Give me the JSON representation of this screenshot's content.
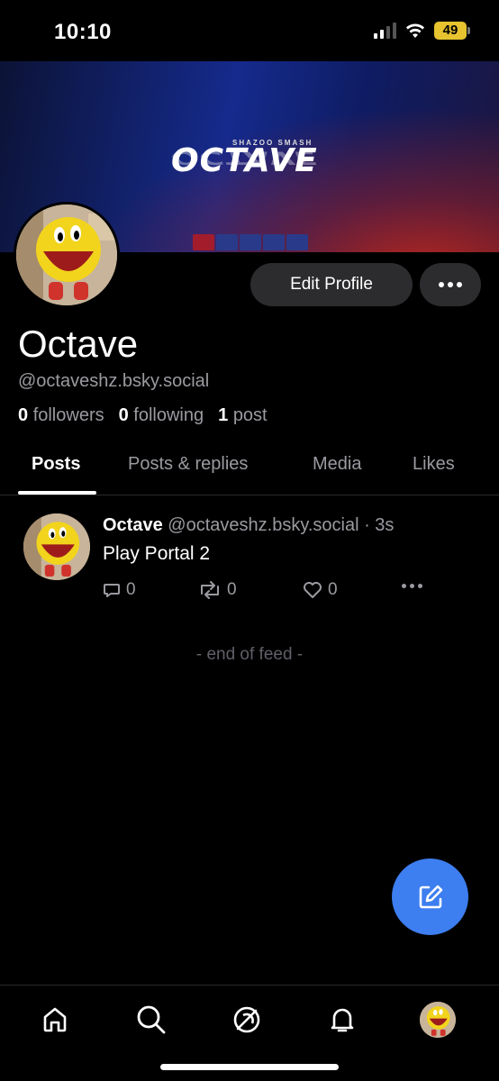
{
  "status_bar": {
    "time": "10:10",
    "battery": "49"
  },
  "banner": {
    "subtitle": "SHAZOO SMASH",
    "title": "OCTAVE"
  },
  "profile": {
    "display_name": "Octave",
    "handle": "@octaveshz.bsky.social",
    "edit_label": "Edit Profile",
    "followers_count": "0",
    "followers_label": "followers",
    "following_count": "0",
    "following_label": "following",
    "posts_count": "1",
    "posts_label": "post"
  },
  "tabs": [
    {
      "label": "Posts",
      "active": true
    },
    {
      "label": "Posts & replies",
      "active": false
    },
    {
      "label": "Media",
      "active": false
    },
    {
      "label": "Likes",
      "active": false
    }
  ],
  "post": {
    "author": "Octave",
    "handle": "@octaveshz.bsky.social",
    "time": "· 3s",
    "text": "Play Portal 2",
    "replies": "0",
    "reposts": "0",
    "likes": "0"
  },
  "feed_end": "- end of feed -",
  "colors": {
    "accent": "#3d7ef0",
    "muted": "#9a9aa0",
    "button_bg": "#2c2c2e"
  },
  "nav": [
    "home-icon",
    "search-icon",
    "feeds-icon",
    "notifications-icon",
    "profile-avatar"
  ]
}
